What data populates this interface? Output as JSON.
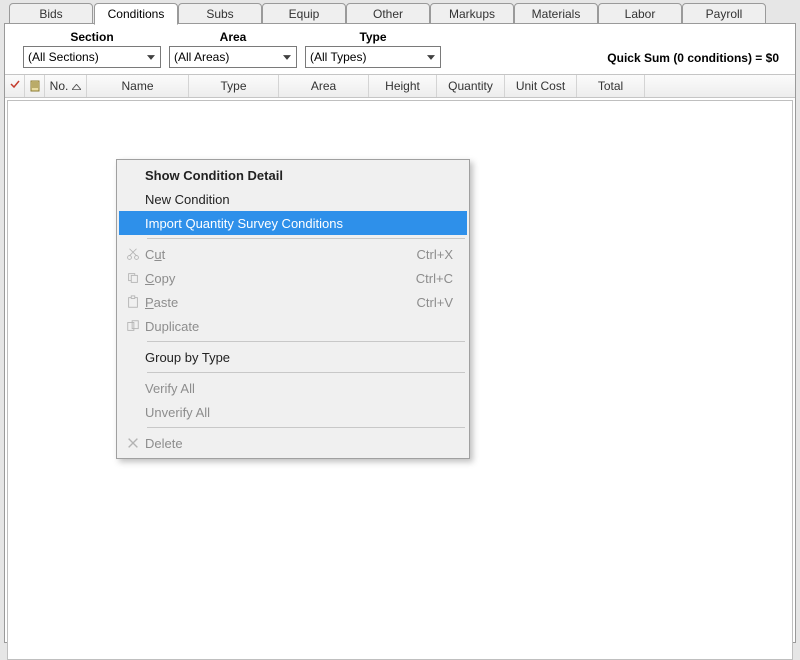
{
  "tabs": [
    {
      "label": "Bids"
    },
    {
      "label": "Conditions"
    },
    {
      "label": "Subs"
    },
    {
      "label": "Equip"
    },
    {
      "label": "Other"
    },
    {
      "label": "Markups"
    },
    {
      "label": "Materials"
    },
    {
      "label": "Labor"
    },
    {
      "label": "Payroll"
    }
  ],
  "active_tab_index": 1,
  "filters": {
    "section": {
      "label": "Section",
      "value": "(All Sections)"
    },
    "area": {
      "label": "Area",
      "value": "(All Areas)"
    },
    "type": {
      "label": "Type",
      "value": "(All Types)"
    }
  },
  "quick_sum": "Quick Sum (0 conditions) = $0",
  "grid": {
    "columns": {
      "no": "No.",
      "name": "Name",
      "type": "Type",
      "area": "Area",
      "height": "Height",
      "quantity": "Quantity",
      "unit_cost": "Unit Cost",
      "total": "Total"
    }
  },
  "context_menu": {
    "show_detail": "Show Condition Detail",
    "new_condition": "New Condition",
    "import_qty": "Import Quantity Survey Conditions",
    "cut": {
      "label_pre": "C",
      "label_accel": "u",
      "label_post": "t",
      "shortcut": "Ctrl+X"
    },
    "copy": {
      "label_pre": "",
      "label_accel": "C",
      "label_post": "opy",
      "shortcut": "Ctrl+C"
    },
    "paste": {
      "label_pre": "",
      "label_accel": "P",
      "label_post": "aste",
      "shortcut": "Ctrl+V"
    },
    "duplicate": "Duplicate",
    "group_by_type": "Group by Type",
    "verify_all": "Verify All",
    "unverify_all": "Unverify All",
    "delete": "Delete"
  }
}
